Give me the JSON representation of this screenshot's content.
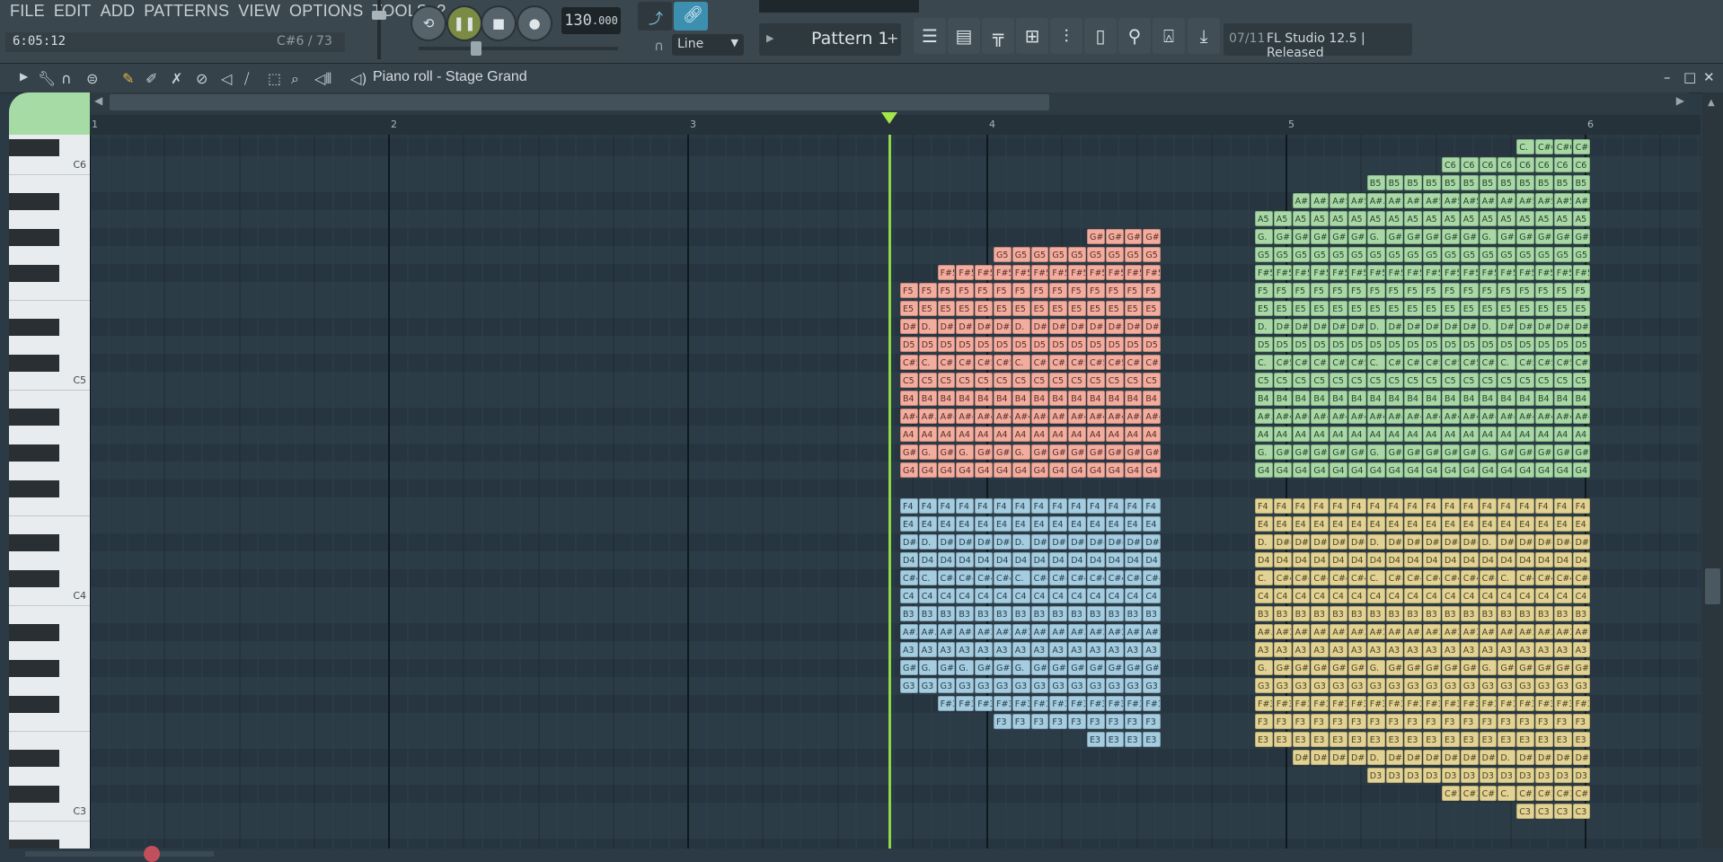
{
  "menu": [
    "FILE",
    "EDIT",
    "ADD",
    "PATTERNS",
    "VIEW",
    "OPTIONS",
    "TOOLS",
    "?"
  ],
  "status": {
    "time": "6:05:12",
    "note": "C#6 / 73"
  },
  "transport": {
    "tempo": "130",
    "tempo_fraction": ".000"
  },
  "snap": "Line",
  "pattern": "Pattern 1",
  "hint": {
    "count": "07/11",
    "text": "FL Studio 12.5 | Released"
  },
  "piano_roll": {
    "title": "Piano roll - Stage Grand",
    "bars": [
      "1",
      "2",
      "3",
      "4",
      "5",
      "6"
    ]
  },
  "keyboard_labels": [
    "C6",
    "C5",
    "C4",
    "C3"
  ],
  "colors": {
    "red": "#f2ad9f",
    "green": "#a9d8a6",
    "blue": "#a6ccdf",
    "yellow": "#e2d293",
    "playhead": "#8ed64a"
  },
  "note_blocks": [
    {
      "color": "red",
      "rows": [
        {
          "note": "G#5",
          "start": 10,
          "len": 4,
          "labels": [
            "G#.",
            "G#.",
            "G#.",
            "G#."
          ]
        },
        {
          "note": "G5",
          "start": 5,
          "len": 9,
          "label": "G5"
        },
        {
          "note": "F#5",
          "start": 2,
          "len": 12,
          "label": "F#5"
        },
        {
          "note": "F5",
          "start": 0,
          "len": 14,
          "label": "F5"
        },
        {
          "note": "E5",
          "start": 0,
          "len": 14,
          "label": "E5"
        },
        {
          "note": "D#5",
          "start": 0,
          "len": 14,
          "labels": [
            "D#5",
            "D.",
            "D#5",
            "D#5",
            "D#5",
            "D#5",
            "D.",
            "D#5",
            "D#5",
            "D#5",
            "D#5",
            "D#5",
            "D#5",
            "D#5"
          ]
        },
        {
          "note": "D5",
          "start": 0,
          "len": 14,
          "label": "D5"
        },
        {
          "note": "C#5",
          "start": 0,
          "len": 14,
          "labels": [
            "C#5",
            "C.",
            "C#5",
            "C#5",
            "C#5",
            "C#5",
            "C.",
            "C#5",
            "C#5",
            "C#5",
            "C#5",
            "C#5",
            "C#5",
            "C#5"
          ]
        },
        {
          "note": "C5",
          "start": 0,
          "len": 14,
          "label": "C5"
        },
        {
          "note": "B4",
          "start": 0,
          "len": 14,
          "label": "B4"
        },
        {
          "note": "A#4",
          "start": 0,
          "len": 14,
          "labels": [
            "A#4",
            "A#.",
            "A#4",
            "A#4",
            "A#4",
            "A#4",
            "A#4",
            "A#4",
            "A#.",
            "A#4",
            "A#4",
            "A#4",
            "A#4",
            "A#4"
          ]
        },
        {
          "note": "A4",
          "start": 0,
          "len": 14,
          "label": "A4"
        },
        {
          "note": "G#4",
          "start": 0,
          "len": 14,
          "labels": [
            "G#.",
            "G.",
            "G#.",
            "G.",
            "G#.",
            "G#.",
            "G.",
            "G#.",
            "G#.",
            "G#.",
            "G#.",
            "G#.",
            "G#.",
            "G#."
          ]
        },
        {
          "note": "G4",
          "start": 0,
          "len": 14,
          "label": "G4"
        }
      ]
    },
    {
      "color": "green",
      "rows": [
        {
          "note": "C#6",
          "start": 14,
          "len": 4,
          "labels": [
            "C.",
            "C#6",
            "C#6",
            "C#6"
          ]
        },
        {
          "note": "C6",
          "start": 10,
          "len": 8,
          "label": "C6"
        },
        {
          "note": "B5",
          "start": 6,
          "len": 12,
          "label": "B5"
        },
        {
          "note": "A#5",
          "start": 2,
          "len": 16,
          "labels": [
            "A#5",
            "A#5",
            "A#5",
            "A#5",
            "A#.",
            "A#5",
            "A#5",
            "A#5",
            "A#5",
            "A#5",
            "A#5",
            "A#.",
            "A#5",
            "A#5",
            "A#5",
            "A#5"
          ]
        },
        {
          "note": "A5",
          "start": 0,
          "len": 18,
          "label": "A5"
        },
        {
          "note": "G#5",
          "start": 0,
          "len": 18,
          "labels": [
            "G.",
            "G#.",
            "G#.",
            "G#.",
            "G#.",
            "G#.",
            "G.",
            "G#.",
            "G#.",
            "G#.",
            "G#.",
            "G#.",
            "G.",
            "G#.",
            "G#.",
            "G#.",
            "G#.",
            "G#."
          ]
        },
        {
          "note": "G5",
          "start": 0,
          "len": 18,
          "label": "G5"
        },
        {
          "note": "F#5",
          "start": 0,
          "len": 18,
          "label": "F#5"
        },
        {
          "note": "F5",
          "start": 0,
          "len": 18,
          "label": "F5"
        },
        {
          "note": "E5",
          "start": 0,
          "len": 18,
          "label": "E5"
        },
        {
          "note": "D#5",
          "start": 0,
          "len": 18,
          "labels": [
            "D.",
            "D#5",
            "D#5",
            "D#5",
            "D#5",
            "D#5",
            "D.",
            "D#5",
            "D#5",
            "D#5",
            "D#5",
            "D#5",
            "D.",
            "D#5",
            "D#5",
            "D#5",
            "D#5",
            "D#5"
          ]
        },
        {
          "note": "D5",
          "start": 0,
          "len": 18,
          "label": "D5"
        },
        {
          "note": "C#5",
          "start": 0,
          "len": 18,
          "labels": [
            "C.",
            "C#5",
            "C#5",
            "C#5",
            "C#5",
            "C#5",
            "C.",
            "C#5",
            "C#5",
            "C#5",
            "C#5",
            "C#5",
            "C#5",
            "C.",
            "C#5",
            "C#5",
            "C#5",
            "C#5"
          ]
        },
        {
          "note": "C5",
          "start": 0,
          "len": 18,
          "label": "C5"
        },
        {
          "note": "B4",
          "start": 0,
          "len": 18,
          "label": "B4"
        },
        {
          "note": "A#4",
          "start": 0,
          "len": 18,
          "labels": [
            "A#.",
            "A#4",
            "A#4",
            "A#4",
            "A#4",
            "A#4",
            "A#4",
            "A#4",
            "A#4",
            "A#4",
            "A#4",
            "A#4",
            "A#4",
            "A#4",
            "A#4",
            "A#4",
            "A#4",
            "A#4"
          ]
        },
        {
          "note": "A4",
          "start": 0,
          "len": 18,
          "label": "A4"
        },
        {
          "note": "G#4",
          "start": 0,
          "len": 18,
          "labels": [
            "G.",
            "G#.",
            "G#.",
            "G#.",
            "G#.",
            "G#.",
            "G.",
            "G#.",
            "G#.",
            "G#.",
            "G#.",
            "G#.",
            "G.",
            "G#.",
            "G#.",
            "G#.",
            "G#.",
            "G#."
          ]
        },
        {
          "note": "G4",
          "start": 0,
          "len": 18,
          "label": "G4"
        }
      ]
    },
    {
      "color": "blue",
      "rows": [
        {
          "note": "F4",
          "start": 0,
          "len": 14,
          "label": "F4"
        },
        {
          "note": "E4",
          "start": 0,
          "len": 14,
          "label": "E4"
        },
        {
          "note": "D#4",
          "start": 0,
          "len": 14,
          "labels": [
            "D#4",
            "D.",
            "D#4",
            "D#4",
            "D#4",
            "D#4",
            "D.",
            "D#4",
            "D#4",
            "D#4",
            "D#4",
            "D#4",
            "D#4",
            "D#4"
          ]
        },
        {
          "note": "D4",
          "start": 0,
          "len": 14,
          "label": "D4"
        },
        {
          "note": "C#4",
          "start": 0,
          "len": 14,
          "labels": [
            "C#4",
            "C.",
            "C#4",
            "C#4",
            "C#4",
            "C#4",
            "C.",
            "C#4",
            "C#4",
            "C#4",
            "C#4",
            "C#4",
            "C#4",
            "C#4"
          ]
        },
        {
          "note": "C4",
          "start": 0,
          "len": 14,
          "label": "C4"
        },
        {
          "note": "B3",
          "start": 0,
          "len": 14,
          "label": "B3"
        },
        {
          "note": "A#3",
          "start": 0,
          "len": 14,
          "labels": [
            "A#3",
            "A#.",
            "A#3",
            "A#3",
            "A#3",
            "A#3",
            "A#3",
            "A#3",
            "A#.",
            "A#3",
            "A#3",
            "A#3",
            "A#3",
            "A#3"
          ]
        },
        {
          "note": "A3",
          "start": 0,
          "len": 14,
          "label": "A3"
        },
        {
          "note": "G#3",
          "start": 0,
          "len": 14,
          "labels": [
            "G#.",
            "G.",
            "G#.",
            "G.",
            "G#.",
            "G#.",
            "G.",
            "G#.",
            "G#.",
            "G#.",
            "G#.",
            "G#.",
            "G#.",
            "G#."
          ]
        },
        {
          "note": "G3",
          "start": 0,
          "len": 14,
          "label": "G3"
        },
        {
          "note": "F#3",
          "start": 2,
          "len": 12,
          "label": "F#3"
        },
        {
          "note": "F3",
          "start": 5,
          "len": 9,
          "label": "F3"
        },
        {
          "note": "E3",
          "start": 10,
          "len": 4,
          "label": "E3"
        }
      ]
    },
    {
      "color": "yellow",
      "rows": [
        {
          "note": "F4",
          "start": 0,
          "len": 18,
          "label": "F4"
        },
        {
          "note": "E4",
          "start": 0,
          "len": 18,
          "label": "E4"
        },
        {
          "note": "D#4",
          "start": 0,
          "len": 18,
          "labels": [
            "D.",
            "D#4",
            "D#4",
            "D#4",
            "D#4",
            "D#4",
            "D.",
            "D#4",
            "D#4",
            "D#4",
            "D#4",
            "D#4",
            "D.",
            "D#4",
            "D#4",
            "D#4",
            "D#4",
            "D#4"
          ]
        },
        {
          "note": "D4",
          "start": 0,
          "len": 18,
          "label": "D4"
        },
        {
          "note": "C#4",
          "start": 0,
          "len": 18,
          "labels": [
            "C.",
            "C#4",
            "C#4",
            "C#4",
            "C#4",
            "C#4",
            "C.",
            "C#4",
            "C#4",
            "C#4",
            "C#4",
            "C#4",
            "C#4",
            "C.",
            "C#4",
            "C#4",
            "C#4",
            "C#4"
          ]
        },
        {
          "note": "C4",
          "start": 0,
          "len": 18,
          "label": "C4"
        },
        {
          "note": "B3",
          "start": 0,
          "len": 18,
          "label": "B3"
        },
        {
          "note": "A#3",
          "start": 0,
          "len": 18,
          "labels": [
            "A#.",
            "A#3",
            "A#3",
            "A#3",
            "A#3",
            "A#3",
            "A#3",
            "A#3",
            "A#3",
            "A#3",
            "A#3",
            "A#3",
            "A#3",
            "A#3",
            "A#3",
            "A#3",
            "A#3",
            "A#3"
          ]
        },
        {
          "note": "A3",
          "start": 0,
          "len": 18,
          "label": "A3"
        },
        {
          "note": "G#3",
          "start": 0,
          "len": 18,
          "labels": [
            "G.",
            "G#.",
            "G#.",
            "G#.",
            "G#.",
            "G#.",
            "G.",
            "G#.",
            "G#.",
            "G#.",
            "G#.",
            "G#.",
            "G.",
            "G#.",
            "G#.",
            "G#.",
            "G#.",
            "G#."
          ]
        },
        {
          "note": "G3",
          "start": 0,
          "len": 18,
          "label": "G3"
        },
        {
          "note": "F#3",
          "start": 0,
          "len": 18,
          "label": "F#3"
        },
        {
          "note": "F3",
          "start": 0,
          "len": 18,
          "label": "F3"
        },
        {
          "note": "E3",
          "start": 0,
          "len": 18,
          "label": "E3"
        },
        {
          "note": "D#3",
          "start": 2,
          "len": 16,
          "labels": [
            "D#3",
            "D#3",
            "D#3",
            "D#3",
            "D.",
            "D#3",
            "D#3",
            "D#3",
            "D#3",
            "D#3",
            "D#3",
            "D.",
            "D#3",
            "D#3",
            "D#3",
            "D#3"
          ]
        },
        {
          "note": "D3",
          "start": 6,
          "len": 12,
          "label": "D3"
        },
        {
          "note": "C#3",
          "start": 10,
          "len": 8,
          "labels": [
            "C#3",
            "C#3",
            "C#3",
            "C.",
            "C#3",
            "C#3",
            "C#3",
            "C#3"
          ]
        },
        {
          "note": "C3",
          "start": 14,
          "len": 4,
          "label": "C3"
        }
      ]
    }
  ]
}
